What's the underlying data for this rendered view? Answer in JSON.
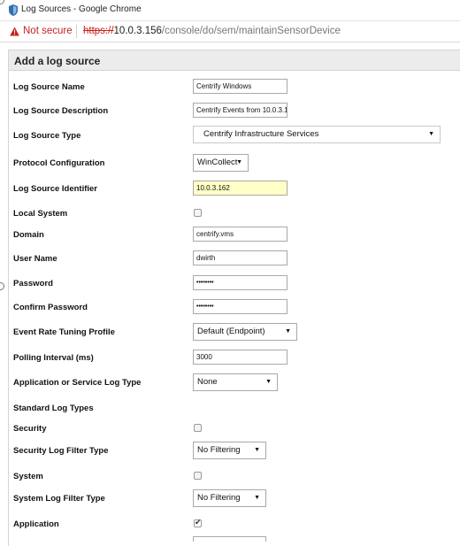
{
  "window": {
    "title": "Log Sources - Google Chrome"
  },
  "address_bar": {
    "security_label": "Not secure",
    "url_scheme": "https://",
    "url_host": "10.0.3.156",
    "url_path": "/console/do/sem/maintainSensorDevice"
  },
  "panel": {
    "title": "Add a log source"
  },
  "form": {
    "log_source_name": {
      "label": "Log Source Name",
      "value": "Centrify Windows"
    },
    "log_source_description": {
      "label": "Log Source Description",
      "value": "Centrify Events from 10.0.3.1"
    },
    "log_source_type": {
      "label": "Log Source Type",
      "value": "Centrify Infrastructure Services"
    },
    "protocol_configuration": {
      "label": "Protocol Configuration",
      "value": "WinCollect"
    },
    "log_source_identifier": {
      "label": "Log Source Identifier",
      "value": "10.0.3.162"
    },
    "local_system": {
      "label": "Local System",
      "checked": false
    },
    "domain": {
      "label": "Domain",
      "value": "centrify.vms"
    },
    "user_name": {
      "label": "User Name",
      "value": "dwirth"
    },
    "password": {
      "label": "Password",
      "value": "••••••••"
    },
    "confirm_password": {
      "label": "Confirm Password",
      "value": "••••••••"
    },
    "event_rate_tuning_profile": {
      "label": "Event Rate Tuning Profile",
      "value": "Default (Endpoint)"
    },
    "polling_interval": {
      "label": "Polling Interval (ms)",
      "value": "3000"
    },
    "application_or_service_log_type": {
      "label": "Application or Service Log Type",
      "value": "None"
    },
    "standard_log_types": {
      "label": "Standard Log Types"
    },
    "security": {
      "label": "Security",
      "checked": false
    },
    "security_log_filter_type": {
      "label": "Security Log Filter Type",
      "value": "No Filtering"
    },
    "system": {
      "label": "System",
      "checked": false
    },
    "system_log_filter_type": {
      "label": "System Log Filter Type",
      "value": "No Filtering"
    },
    "application": {
      "label": "Application",
      "checked": true
    }
  },
  "icons": {
    "favicon": "log-sources-favicon",
    "warning": "warning-triangle-icon",
    "dropdown": "caret-down-icon"
  },
  "colors": {
    "not_secure_red": "#c5221f",
    "highlight_field": "#ffffc6",
    "panel_header_bg": "#ececec"
  }
}
